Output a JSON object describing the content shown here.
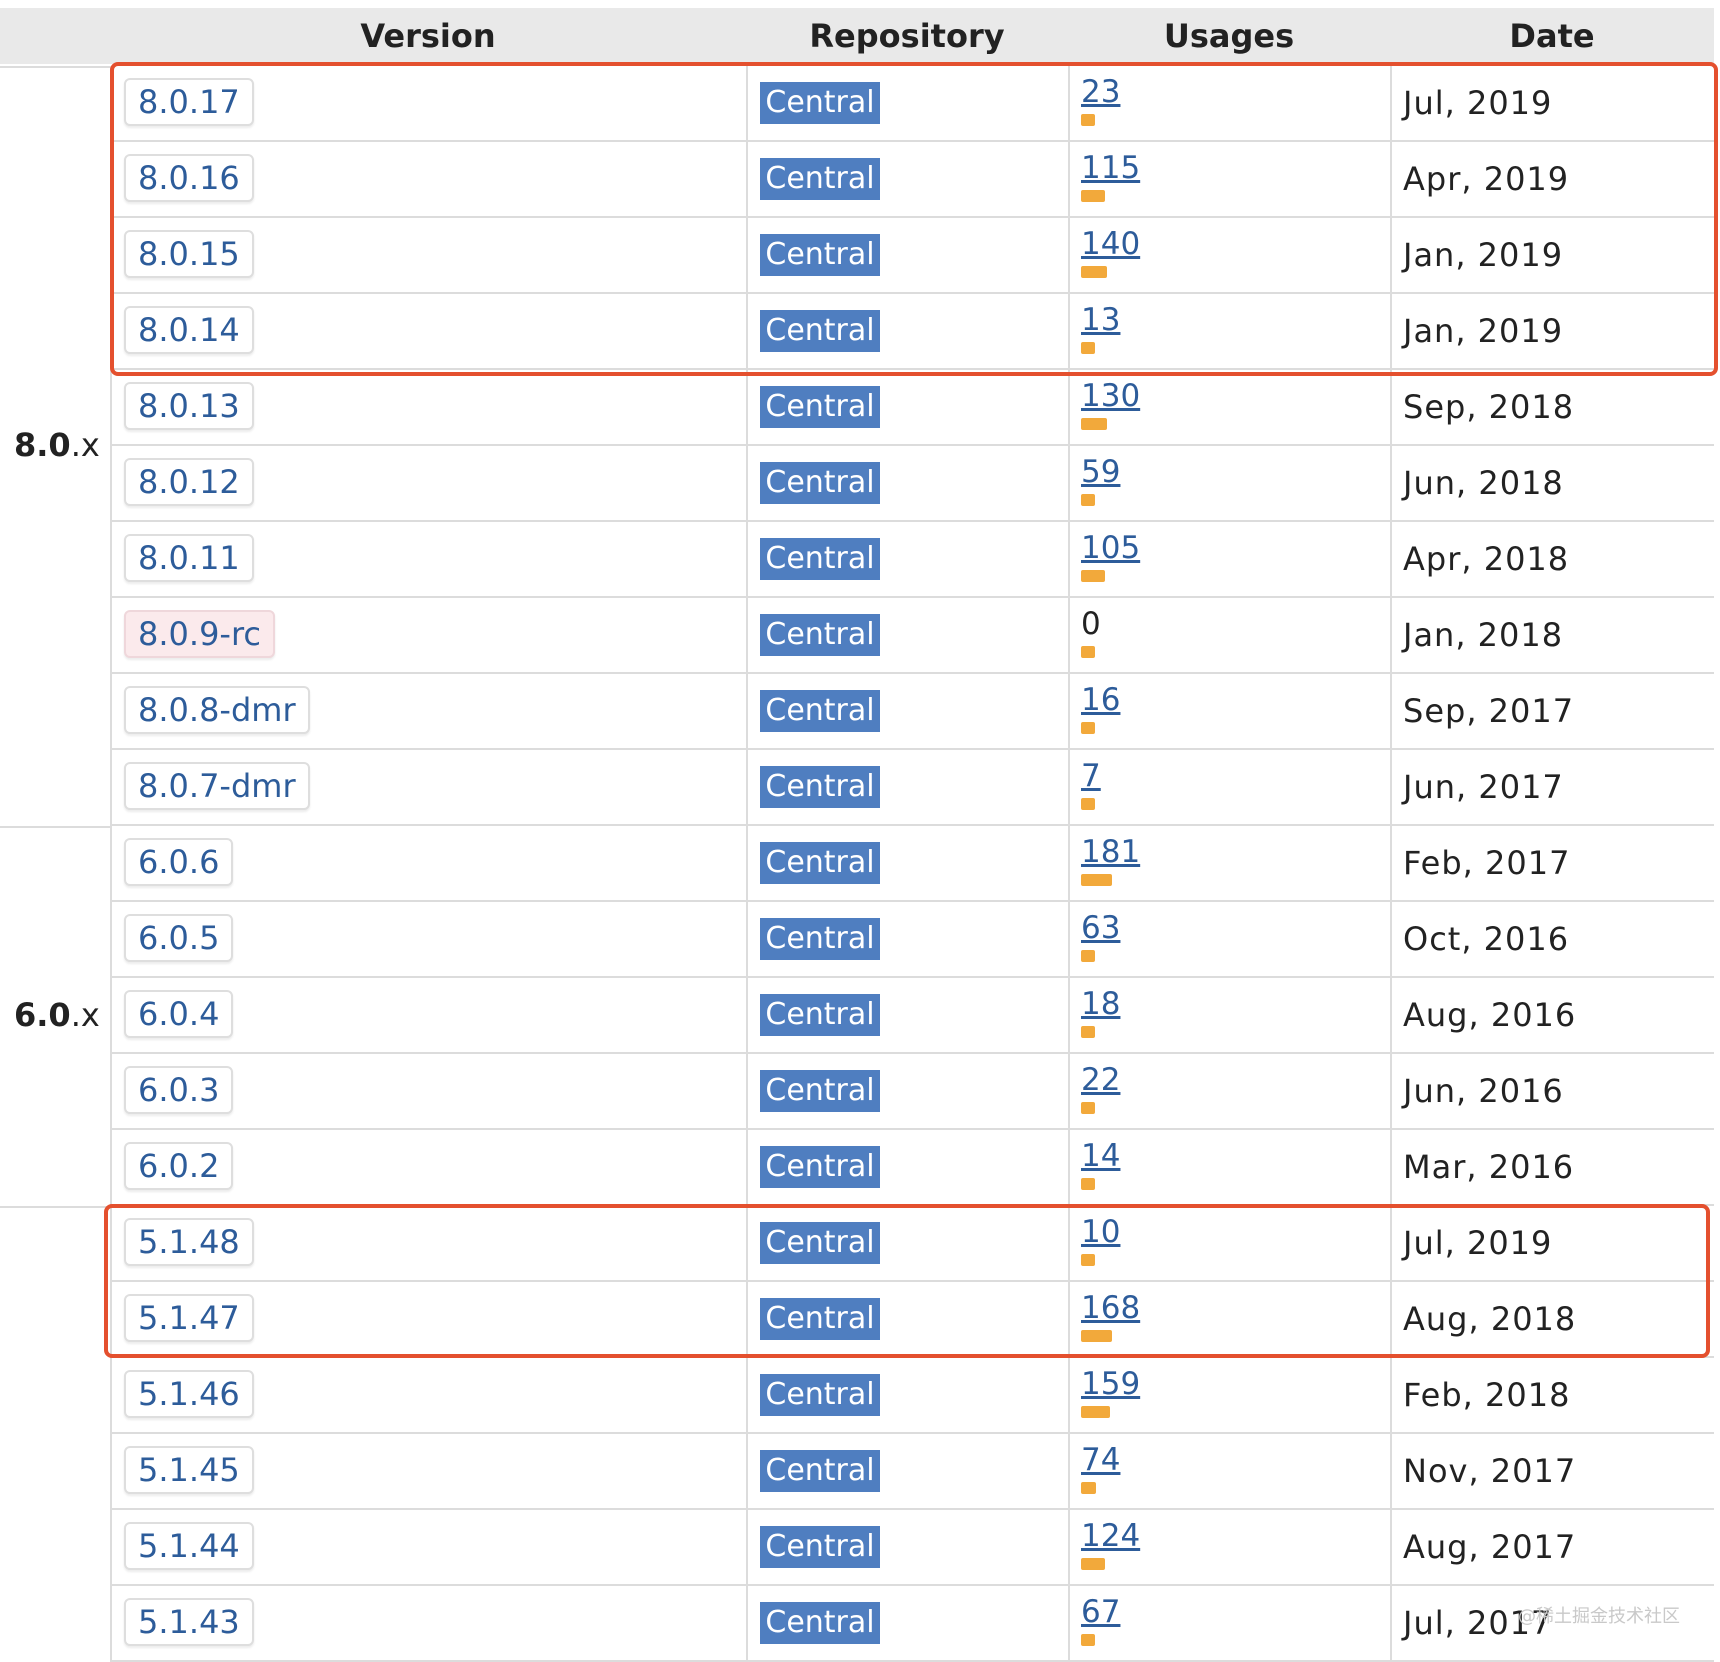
{
  "header": {
    "version": "Version",
    "repository": "Repository",
    "usages": "Usages",
    "date": "Date"
  },
  "groups": [
    {
      "major": "8.0",
      "suffix": ".x"
    },
    {
      "major": "6.0",
      "suffix": ".x"
    }
  ],
  "rows": [
    {
      "version": "8.0.17",
      "repo": "Central",
      "usages": "23",
      "usage_level": 0.11,
      "date": "Jul, 2019"
    },
    {
      "version": "8.0.16",
      "repo": "Central",
      "usages": "115",
      "usage_level": 0.55,
      "date": "Apr, 2019"
    },
    {
      "version": "8.0.15",
      "repo": "Central",
      "usages": "140",
      "usage_level": 0.58,
      "date": "Jan, 2019"
    },
    {
      "version": "8.0.14",
      "repo": "Central",
      "usages": "13",
      "usage_level": 0.08,
      "date": "Jan, 2019"
    },
    {
      "version": "8.0.13",
      "repo": "Central",
      "usages": "130",
      "usage_level": 0.58,
      "date": "Sep, 2018"
    },
    {
      "version": "8.0.12",
      "repo": "Central",
      "usages": "59",
      "usage_level": 0.3,
      "date": "Jun, 2018"
    },
    {
      "version": "8.0.11",
      "repo": "Central",
      "usages": "105",
      "usage_level": 0.55,
      "date": "Apr, 2018"
    },
    {
      "version": "8.0.9-rc",
      "repo": "Central",
      "usages": "0",
      "usage_level": 0.05,
      "date": "Jan, 2018",
      "prerelease": true
    },
    {
      "version": "8.0.8-dmr",
      "repo": "Central",
      "usages": "16",
      "usage_level": 0.09,
      "date": "Sep, 2017"
    },
    {
      "version": "8.0.7-dmr",
      "repo": "Central",
      "usages": "7",
      "usage_level": 0.06,
      "date": "Jun, 2017"
    },
    {
      "version": "6.0.6",
      "repo": "Central",
      "usages": "181",
      "usage_level": 0.7,
      "date": "Feb, 2017"
    },
    {
      "version": "6.0.5",
      "repo": "Central",
      "usages": "63",
      "usage_level": 0.3,
      "date": "Oct, 2016"
    },
    {
      "version": "6.0.4",
      "repo": "Central",
      "usages": "18",
      "usage_level": 0.09,
      "date": "Aug, 2016"
    },
    {
      "version": "6.0.3",
      "repo": "Central",
      "usages": "22",
      "usage_level": 0.11,
      "date": "Jun, 2016"
    },
    {
      "version": "6.0.2",
      "repo": "Central",
      "usages": "14",
      "usage_level": 0.08,
      "date": "Mar, 2016"
    },
    {
      "version": "5.1.48",
      "repo": "Central",
      "usages": "10",
      "usage_level": 0.07,
      "date": "Jul, 2019"
    },
    {
      "version": "5.1.47",
      "repo": "Central",
      "usages": "168",
      "usage_level": 0.7,
      "date": "Aug, 2018"
    },
    {
      "version": "5.1.46",
      "repo": "Central",
      "usages": "159",
      "usage_level": 0.65,
      "date": "Feb, 2018"
    },
    {
      "version": "5.1.45",
      "repo": "Central",
      "usages": "74",
      "usage_level": 0.35,
      "date": "Nov, 2017"
    },
    {
      "version": "5.1.44",
      "repo": "Central",
      "usages": "124",
      "usage_level": 0.55,
      "date": "Aug, 2017"
    },
    {
      "version": "5.1.43",
      "repo": "Central",
      "usages": "67",
      "usage_level": 0.3,
      "date": "Jul, 2017"
    }
  ],
  "watermark": "@稀土掘金技术社区",
  "colors": {
    "accent_highlight": "#e4502e",
    "repo_badge": "#4f7ec0",
    "usage_bar": "#f2a93b",
    "link": "#2d5c9a"
  }
}
